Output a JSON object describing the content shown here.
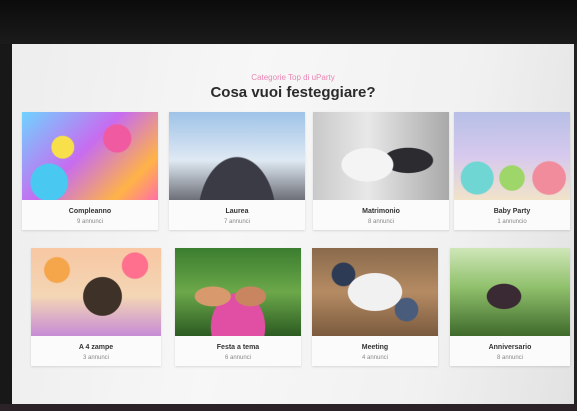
{
  "header": {
    "eyebrow": "Categorie Top di uParty",
    "title": "Cosa vuoi festeggiare?"
  },
  "categories": [
    {
      "name": "Compleanno",
      "count": "9 annunci",
      "image": "birthday-cake-photo"
    },
    {
      "name": "Laurea",
      "count": "7 annunci",
      "image": "graduation-caps-photo"
    },
    {
      "name": "Matrimonio",
      "count": "8 annunci",
      "image": "wedding-couple-photo"
    },
    {
      "name": "Baby Party",
      "count": "1 annuncio",
      "image": "baby-cupcakes-photo"
    },
    {
      "name": "A 4 zampe",
      "count": "3 annunci",
      "image": "dog-party-photo"
    },
    {
      "name": "Festa a tema",
      "count": "6 annunci",
      "image": "hula-dancers-photo"
    },
    {
      "name": "Meeting",
      "count": "4 annunci",
      "image": "meeting-table-photo"
    },
    {
      "name": "Anniversario",
      "count": "8 annunci",
      "image": "couple-park-photo"
    }
  ],
  "colors": {
    "accent": "#e986b4",
    "title": "#2b2b2b",
    "background": "#f5f5f5"
  }
}
